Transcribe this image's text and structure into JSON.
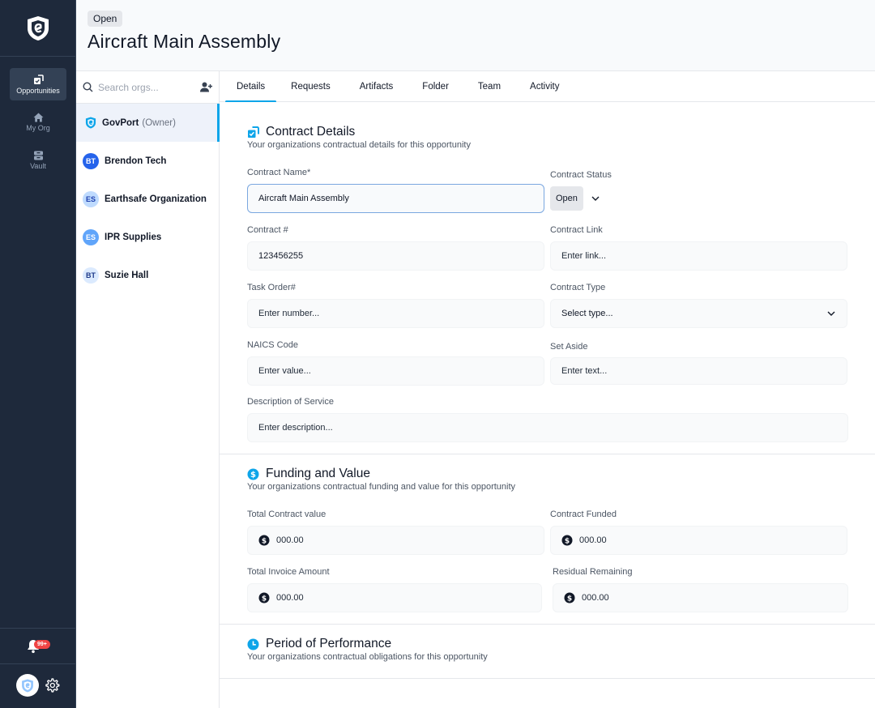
{
  "rail": {
    "nav": [
      {
        "label": "Opportunities",
        "icon": "opportunities-icon",
        "active": true
      },
      {
        "label": "My Org",
        "icon": "home-icon",
        "active": false
      },
      {
        "label": "Vault",
        "icon": "vault-icon",
        "active": false
      }
    ],
    "notifications_badge": "99+"
  },
  "header": {
    "status": "Open",
    "title": "Aircraft Main Assembly"
  },
  "orgs": {
    "search_placeholder": "Search orgs...",
    "items": [
      {
        "name": "GovPort",
        "suffix": "(Owner)",
        "initials": "",
        "active": true
      },
      {
        "name": "Brendon Tech",
        "initials": "BT",
        "avatar_bg": "#2563eb",
        "avatar_fg": "#ffffff"
      },
      {
        "name": "Earthsafe Organization",
        "initials": "ES",
        "avatar_bg": "#bfdbfe",
        "avatar_fg": "#1e40af"
      },
      {
        "name": "IPR Supplies",
        "initials": "ES",
        "avatar_bg": "#60a5fa",
        "avatar_fg": "#ffffff"
      },
      {
        "name": "Suzie Hall",
        "initials": "BT",
        "avatar_bg": "#dbeafe",
        "avatar_fg": "#1e3a8a"
      }
    ]
  },
  "tabs": [
    "Details",
    "Requests",
    "Artifacts",
    "Folder",
    "Team",
    "Activity"
  ],
  "contract_details": {
    "title": "Contract Details",
    "subtitle": "Your organizations contractual details for this opportunity",
    "contract_name_label": "Contract Name*",
    "contract_name_value": "Aircraft Main Assembly",
    "contract_status_label": "Contract Status",
    "contract_status_value": "Open",
    "contract_number_label": "Contract #",
    "contract_number_value": "123456255",
    "contract_link_label": "Contract Link",
    "contract_link_placeholder": "Enter link...",
    "task_order_label": "Task Order#",
    "task_order_placeholder": "Enter number...",
    "contract_type_label": "Contract Type",
    "contract_type_placeholder": "Select type...",
    "naics_label": "NAICS Code",
    "naics_placeholder": "Enter value...",
    "set_aside_label": "Set Aside",
    "set_aside_placeholder": "Enter text...",
    "description_label": "Description of Service",
    "description_placeholder": "Enter description..."
  },
  "funding": {
    "title": "Funding and Value",
    "subtitle": "Your organizations contractual funding and value for this opportunity",
    "total_contract_label": "Total Contract value",
    "total_contract_value": "000.00",
    "contract_funded_label": "Contract Funded",
    "contract_funded_value": "000.00",
    "total_invoice_label": "Total Invoice Amount",
    "total_invoice_value": "000.00",
    "residual_label": "Residual Remaining",
    "residual_value": "000.00"
  },
  "performance": {
    "title": "Period of Performance",
    "subtitle": "Your organizations contractual obligations for this opportunity"
  },
  "colors": {
    "accent": "#0ea5e9",
    "rail_bg": "#1e293b",
    "badge": "#ef4444"
  }
}
